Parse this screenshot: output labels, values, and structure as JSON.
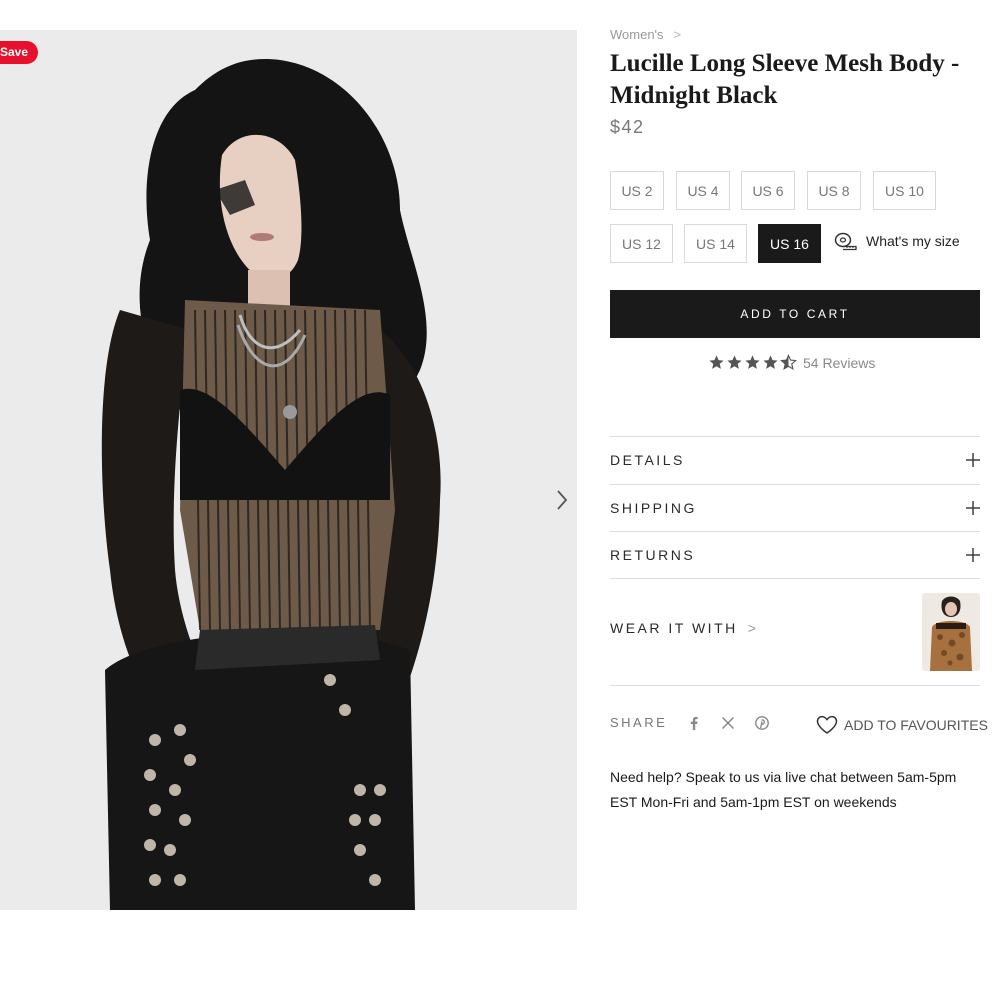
{
  "gallery": {
    "badge": "Save",
    "next_icon": "chevron-right-icon"
  },
  "product": {
    "breadcrumb": {
      "category": "Women's",
      "separator": ">"
    },
    "title": "Lucille Long Sleeve Mesh Body - Midnight Black",
    "price": "$42",
    "sizes": [
      {
        "label": "US 2",
        "selected": false
      },
      {
        "label": "US 4",
        "selected": false
      },
      {
        "label": "US 6",
        "selected": false
      },
      {
        "label": "US 8",
        "selected": false
      },
      {
        "label": "US 10",
        "selected": false
      },
      {
        "label": "US 12",
        "selected": false
      },
      {
        "label": "US 14",
        "selected": false
      },
      {
        "label": "US 16",
        "selected": true
      }
    ],
    "size_guide": {
      "label": "What's my size",
      "icon": "measuring-tape-icon"
    },
    "add_to_cart": "ADD TO CART",
    "rating": {
      "stars": 4.5,
      "max": 5,
      "count_label": "54 Reviews"
    }
  },
  "accordion": [
    {
      "label": "DETAILS",
      "icon": "plus-icon"
    },
    {
      "label": "SHIPPING",
      "icon": "plus-icon"
    },
    {
      "label": "RETURNS",
      "icon": "plus-icon"
    }
  ],
  "wear_it_with": {
    "label": "WEAR IT WITH",
    "chevron": ">"
  },
  "share": {
    "label": "SHARE",
    "icons": [
      "facebook-icon",
      "x-icon",
      "pinterest-icon"
    ]
  },
  "favourites": {
    "label": "ADD TO FAVOURITES",
    "icon": "heart-icon"
  },
  "help_text": "Need help? Speak to us via live chat between 5am-5pm EST Mon-Fri and 5am-1pm EST on weekends",
  "colors": {
    "badge": "#e8112d",
    "primary": "#1a1a1a",
    "muted": "#777777",
    "border": "#d9d9d9",
    "star": "#555555"
  }
}
